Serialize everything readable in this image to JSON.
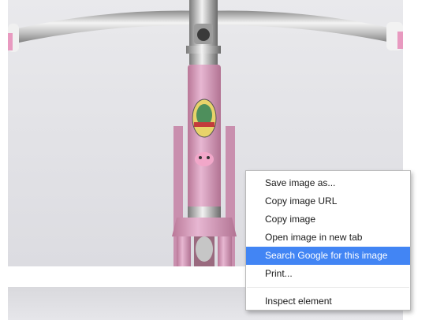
{
  "context_menu": {
    "items": [
      {
        "label": "Save image as..."
      },
      {
        "label": "Copy image URL"
      },
      {
        "label": "Copy image"
      },
      {
        "label": "Open image in new tab"
      },
      {
        "label": "Search Google for this image",
        "highlighted": true
      },
      {
        "label": "Print..."
      }
    ],
    "footer_items": [
      {
        "label": "Inspect element"
      }
    ],
    "highlight_color": "#4285f4"
  },
  "photo": {
    "subject": "bicycle-handlebar-and-pink-frame",
    "frame_color": "#d9a3c3",
    "background_color": "#e4e4e8"
  }
}
